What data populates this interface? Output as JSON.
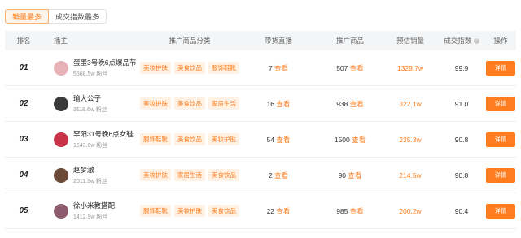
{
  "tabs": [
    {
      "label": "销量最多",
      "active": true
    },
    {
      "label": "成交指数最多",
      "active": false
    }
  ],
  "columns": {
    "rank": "排名",
    "anchor": "播主",
    "category": "推广商品分类",
    "live": "带货直播",
    "goods": "推广商品",
    "sales": "预估销量",
    "index": "成交指数",
    "op": "操作"
  },
  "rows": [
    {
      "rank": "01",
      "name": "蛋蛋3号晚6点爆品节",
      "fans": "5568.5w 粉丝",
      "tags": [
        "美妆护肤",
        "美食饮品",
        "服饰鞋靴"
      ],
      "live_count": "7",
      "live_link": "查看",
      "goods_count": "507",
      "goods_link": "查看",
      "sales": "1329.7w",
      "index": "99.9",
      "action": "详情",
      "avatar_color": "#e8b3b8"
    },
    {
      "rank": "02",
      "name": "瑜大公子",
      "fans": "3118.6w 粉丝",
      "tags": [
        "美妆护肤",
        "美食饮品",
        "家居生活"
      ],
      "live_count": "16",
      "live_link": "查看",
      "goods_count": "938",
      "goods_link": "查看",
      "sales": "322.1w",
      "index": "91.0",
      "action": "详情",
      "avatar_color": "#3a3a3a"
    },
    {
      "rank": "03",
      "name": "罕阳31号晚6点女鞋...",
      "fans": "1643.0w 粉丝",
      "tags": [
        "服饰鞋靴",
        "美食饮品",
        "美妆护肤"
      ],
      "live_count": "54",
      "live_link": "查看",
      "goods_count": "1500",
      "goods_link": "查看",
      "sales": "235.3w",
      "index": "90.8",
      "action": "详情",
      "avatar_color": "#c9334a"
    },
    {
      "rank": "04",
      "name": "赵梦澈",
      "fans": "2011.9w 粉丝",
      "tags": [
        "美妆护肤",
        "家居生活",
        "美食饮品"
      ],
      "live_count": "2",
      "live_link": "查看",
      "goods_count": "90",
      "goods_link": "查看",
      "sales": "214.5w",
      "index": "90.8",
      "action": "详情",
      "avatar_color": "#6b4a3a"
    },
    {
      "rank": "05",
      "name": "徐小米教搭配",
      "fans": "1412.9w 粉丝",
      "tags": [
        "服饰鞋靴",
        "美妆护肤",
        "美食饮品"
      ],
      "live_count": "22",
      "live_link": "查看",
      "goods_count": "985",
      "goods_link": "查看",
      "sales": "200.2w",
      "index": "90.4",
      "action": "详情",
      "avatar_color": "#8a5c6e"
    }
  ],
  "colors": {
    "accent": "#ff7d1e",
    "tag_bg": "#fff1e4",
    "header_bg": "#f4f5f7"
  }
}
